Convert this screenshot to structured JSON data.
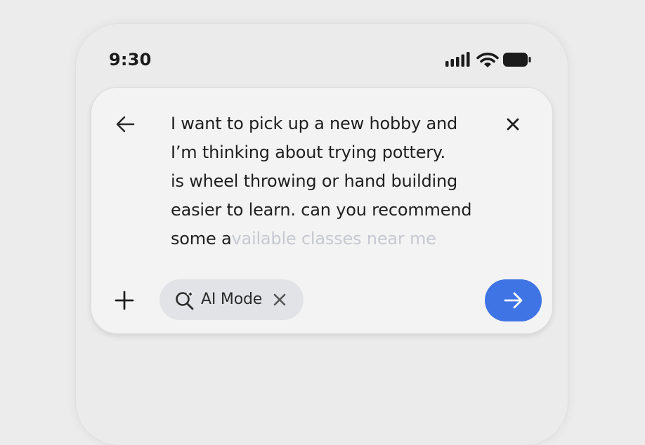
{
  "status_bar": {
    "time": "9:30",
    "icons": [
      "signal-icon",
      "wifi-icon",
      "battery-icon"
    ]
  },
  "search": {
    "query_lines": [
      "I want to pick up a new hobby and",
      "I’m thinking about trying pottery.",
      "is wheel throwing or hand building",
      "easier to learn. can you recommend"
    ],
    "last_line_typed": "some a",
    "last_line_suggestion": "vailable classes near me"
  },
  "mode_chip": {
    "label": "AI Mode",
    "icon": "ai-search-sparkle-icon"
  },
  "colors": {
    "accent": "#3f74e5",
    "background": "#ececec",
    "card": "#f3f3f3",
    "chip": "#e2e3e6",
    "suggestion_text": "#c6c9d0"
  }
}
